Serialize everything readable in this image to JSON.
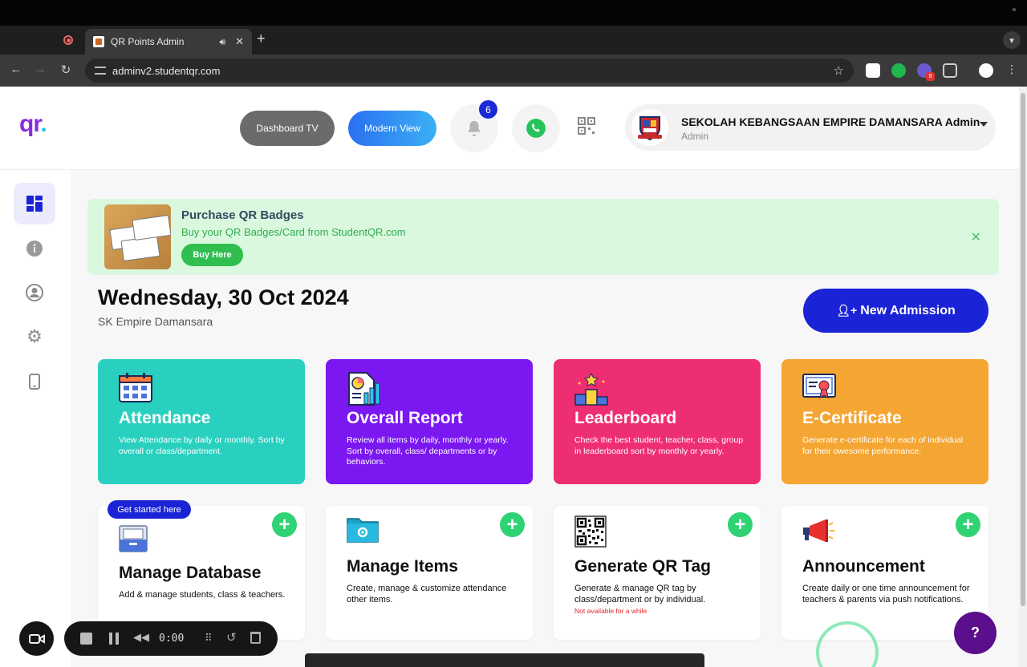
{
  "browser": {
    "tab_title": "QR Points Admin",
    "tab_close": "✕",
    "new_tab": "+",
    "url": "adminv2.studentqr.com",
    "ext_badge": "9"
  },
  "header": {
    "logo_main": "qr",
    "logo_dot": ".",
    "dashboard_tv_label": "Dashboard TV",
    "modern_view_label": "Modern View",
    "notification_count": "6",
    "school_name": "SEKOLAH KEBANGSAAN EMPIRE DAMANSARA Admin",
    "role": "Admin"
  },
  "promo": {
    "title": "Purchase QR Badges",
    "subtitle": "Buy your QR Badges/Card from StudentQR.com",
    "button": "Buy Here",
    "close": "✕"
  },
  "main": {
    "date": "Wednesday, 30 Oct 2024",
    "school": "SK Empire Damansara",
    "new_admission": "New Admission"
  },
  "feature_cards": [
    {
      "title": "Attendance",
      "desc": "View Attendance by daily or monthly. Sort by overall or class/department.",
      "color": "#2ad0bf"
    },
    {
      "title": "Overall Report",
      "desc": "Review all items by daily, monthly or yearly. Sort by overall, class/ departments or by behaviors.",
      "color": "#7b17f0"
    },
    {
      "title": "Leaderboard",
      "desc": "Check the best student, teacher, class, group in leaderboard sort by monthly or yearly.",
      "color": "#ee2e72"
    },
    {
      "title": "E-Certificate",
      "desc": "Generate e-certificate for each of individual for their owesome performance.",
      "color": "#f5a531"
    }
  ],
  "manage_cards": [
    {
      "title": "Manage Database",
      "desc": "Add & manage students, class & teachers.",
      "badge": "Get started here",
      "plus": "+"
    },
    {
      "title": "Manage Items",
      "desc": "Create, manage & customize attendance other items.",
      "plus": "+"
    },
    {
      "title": "Generate QR Tag",
      "desc": "Generate & manage QR tag by class/department or by individual.",
      "note": "Not available for a while",
      "plus": "+"
    },
    {
      "title": "Announcement",
      "desc": "Create daily or one time announcement for teachers & parents via push notifications.",
      "plus": "+"
    }
  ],
  "help": {
    "label": "?"
  },
  "recorder": {
    "time": "0:00",
    "rewind": "◀◀",
    "grid": "⠿",
    "undo": "↺"
  }
}
